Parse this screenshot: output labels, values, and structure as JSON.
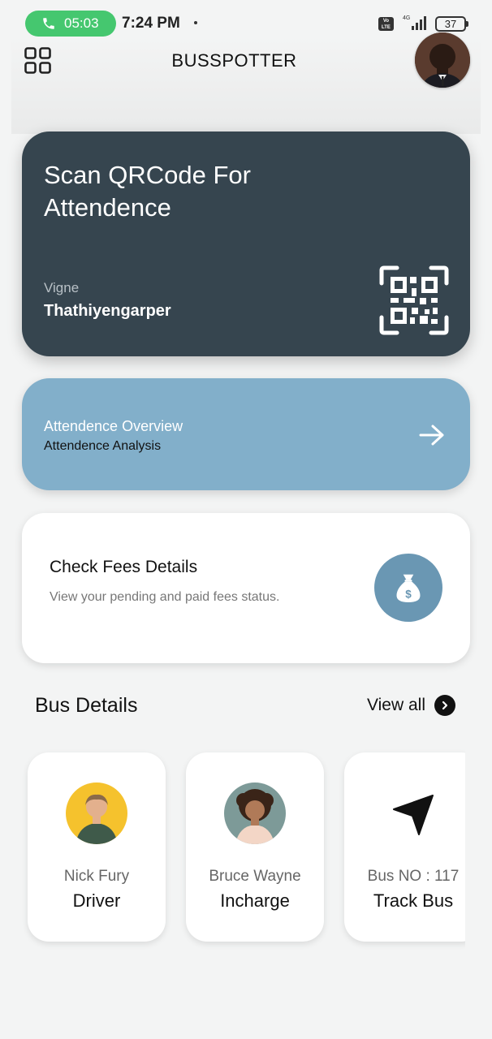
{
  "status_bar": {
    "call_timer": "05:03",
    "time": "7:24 PM",
    "network": "4G",
    "volte": "Vo LTE",
    "battery": "37"
  },
  "header": {
    "title": "BUSSPOTTER"
  },
  "scan_card": {
    "title": "Scan QRCode For Attendence",
    "user_first": "Vigne",
    "user_last": "Thathiyengarper"
  },
  "overview_card": {
    "title": "Attendence Overview",
    "subtitle": "Attendence Analysis"
  },
  "fees_card": {
    "title": "Check Fees Details",
    "subtitle": "View your pending and paid fees status."
  },
  "bus_details": {
    "title": "Bus Details",
    "view_all": "View all",
    "cards": [
      {
        "name": "Nick Fury",
        "role": "Driver",
        "icon": "driver-avatar"
      },
      {
        "name": "Bruce Wayne",
        "role": "Incharge",
        "icon": "incharge-avatar"
      },
      {
        "name": "Bus NO : 117",
        "role": "Track Bus",
        "icon": "navigation-arrow-icon"
      }
    ]
  },
  "colors": {
    "scan_card": "#36454f",
    "overview_card": "#82afca",
    "fees_icon": "#6a97b3",
    "call_pill": "#45c76f"
  }
}
